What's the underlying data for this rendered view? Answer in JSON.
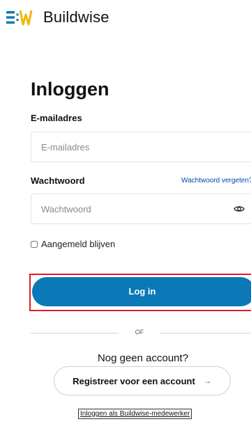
{
  "header": {
    "logo_name": "Buildwise",
    "logo_icon": "buildwise-logo-icon",
    "brand_color": "#0b78b7"
  },
  "login": {
    "title": "Inloggen",
    "email_label": "E-mailadres",
    "email_placeholder": "E-mailadres",
    "email_value": "",
    "password_label": "Wachtwoord",
    "password_placeholder": "Wachtwoord",
    "password_value": "",
    "forgot_link": "Wachtwoord vergeten?",
    "show_password_icon": "eye-icon",
    "remember_label": "Aangemeld blijven",
    "remember_checked": false,
    "submit_label": "Log in",
    "highlight_color": "#e01a2b"
  },
  "divider": {
    "label": "OF"
  },
  "register": {
    "prompt": "Nog geen account?",
    "button_label": "Registreer voor een account",
    "arrow_icon": "arrow-right-icon",
    "arrow_glyph": "→"
  },
  "footer": {
    "employee_link": "Inloggen als Buildwise-medewerker"
  }
}
